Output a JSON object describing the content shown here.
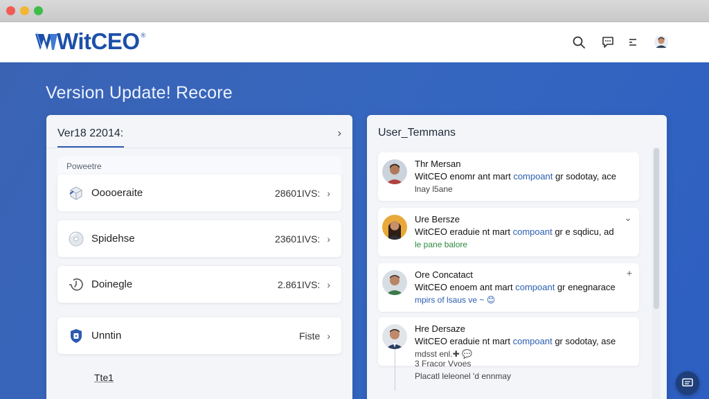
{
  "window": {
    "controls": [
      "close",
      "minimize",
      "zoom"
    ]
  },
  "header": {
    "brand": "WitCEO",
    "brand_mark": "®",
    "icons": [
      "search-icon",
      "chat-icon",
      "menu-icon",
      "user-avatar"
    ]
  },
  "page": {
    "title": "Version Update! Recore"
  },
  "versions": {
    "heading": "Ver18 22014:",
    "section_label": "Poweetre",
    "rows": [
      {
        "label": "Ooooeraite",
        "value": "28601IVS:",
        "icon": "cube-icon"
      },
      {
        "label": "Spidehse",
        "value": "23601IVS:",
        "icon": "disc-icon"
      },
      {
        "label": "Doinegle",
        "value": "2.861IVS:",
        "icon": "history-icon"
      },
      {
        "label": "Unntin",
        "value": "Fiste",
        "icon": "shield-icon"
      }
    ],
    "footer_link": "Tte1"
  },
  "user_panel": {
    "title": "User_Temmans",
    "messages": [
      {
        "name": "Thr Mersan",
        "line_start": "WitCEO enomr ant mart ",
        "line_link": "compoant",
        "line_end": " gr sodotay, ace",
        "meta": "lnay l5ane",
        "meta_style": "plain",
        "action": ""
      },
      {
        "name": "Ure Bersze",
        "line_start": "WitCEO eraduie nt mart ",
        "line_link": "compoant",
        "line_end": " gr e sqdicu, ad",
        "meta": "le pane  balore",
        "meta_style": "green",
        "action": "⌄"
      },
      {
        "name": "Ore Concatact",
        "line_start": "WitCEO enoem ant mart ",
        "line_link": "compoant",
        "line_end": " gr enegnarace",
        "meta": "mpirs of lsaus ve ~ 😊",
        "meta_style": "blue",
        "action": "+"
      },
      {
        "name": "Hre Dersaze",
        "line_start": "WitCEO eraduie nt mart ",
        "line_link": "compoant",
        "line_end": " gr sodotay, ase",
        "meta": "mdsst enl.✚ 💬",
        "meta_style": "plain",
        "action": ""
      }
    ],
    "thread_lines": [
      "3 Fracor  Vvoes",
      "Placatl leleonel  'd ennmay"
    ]
  },
  "colors": {
    "brand": "#1c4fa8",
    "accent": "#2e5bb0",
    "background": "#2f5fb8"
  }
}
